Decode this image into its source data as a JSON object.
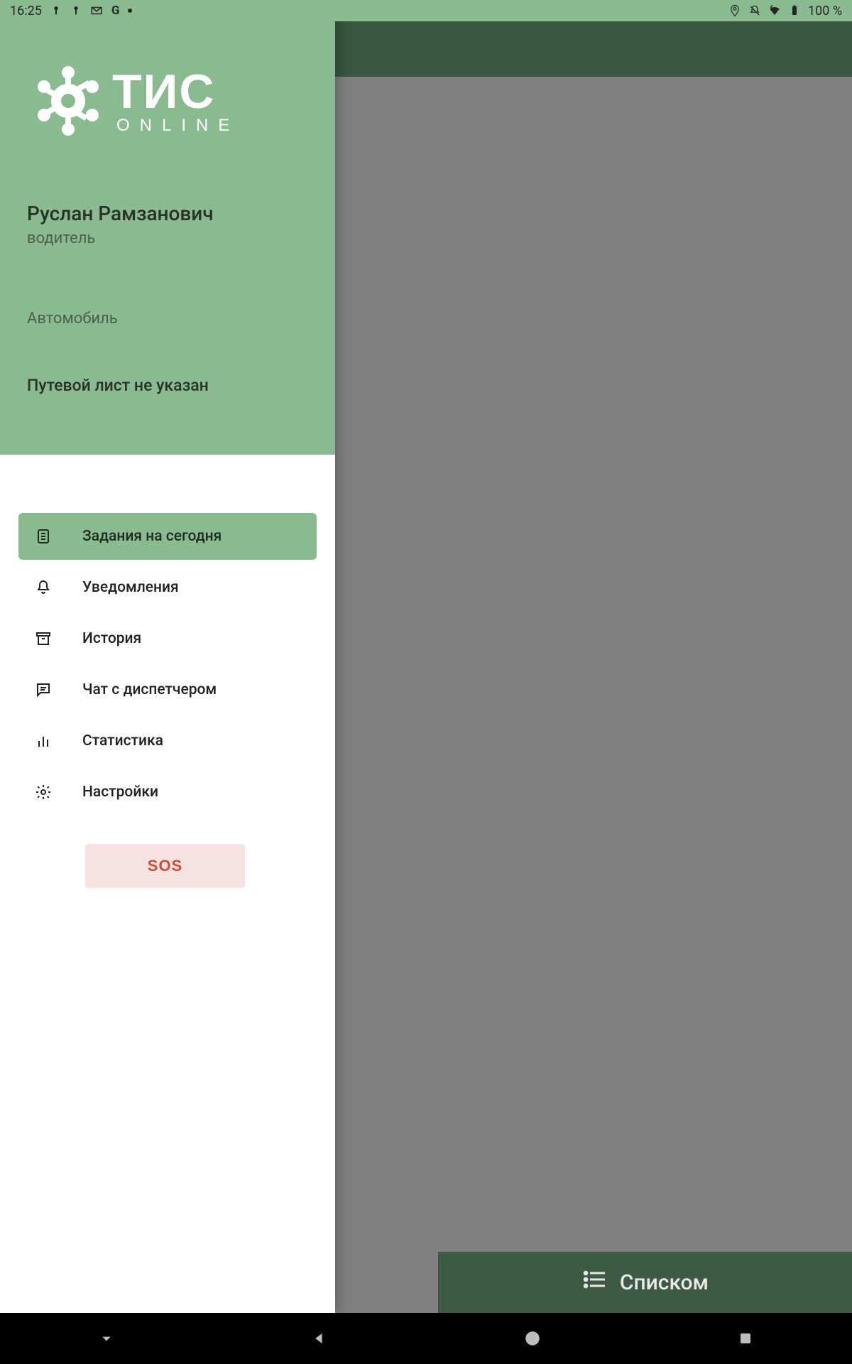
{
  "status_bar": {
    "time": "16:25",
    "battery_text": "100 %"
  },
  "background_app": {
    "bottom_button": "Списком"
  },
  "drawer": {
    "user_name": "Руслан Рамзанович",
    "user_role": "водитель",
    "vehicle_label": "Автомобиль",
    "waybill_status": "Путевой лист не указан",
    "menu": [
      {
        "label": "Задания на сегодня",
        "icon": "clipboard-icon",
        "selected": true
      },
      {
        "label": "Уведомления",
        "icon": "bell-icon",
        "selected": false
      },
      {
        "label": "История",
        "icon": "archive-icon",
        "selected": false
      },
      {
        "label": "Чат с диспетчером",
        "icon": "chat-icon",
        "selected": false
      },
      {
        "label": "Статистика",
        "icon": "stats-icon",
        "selected": false
      },
      {
        "label": "Настройки",
        "icon": "gear-icon",
        "selected": false
      }
    ],
    "sos_label": "SOS"
  }
}
